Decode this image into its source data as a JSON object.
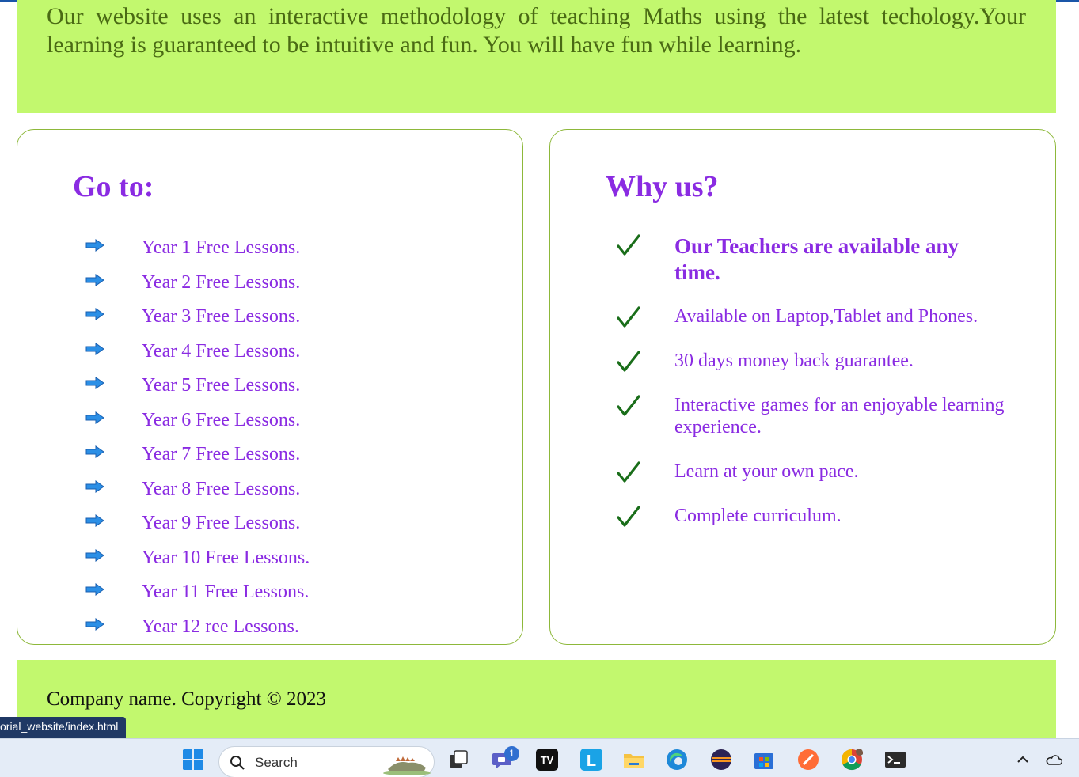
{
  "hero": {
    "text": "Our website uses an interactive methodology of teaching Maths using the latest techology.Your learning is guaranteed to be intuitive and fun. You will have fun while learning."
  },
  "goto": {
    "title": "Go to:",
    "items": [
      "Year 1 Free Lessons.",
      "Year 2 Free Lessons.",
      "Year 3 Free Lessons.",
      "Year 4 Free Lessons.",
      "Year 5 Free Lessons.",
      "Year 6 Free Lessons.",
      "Year 7 Free Lessons.",
      "Year 8 Free Lessons.",
      "Year 9 Free Lessons.",
      "Year 10 Free Lessons.",
      "Year 11 Free Lessons.",
      "Year 12 ree Lessons."
    ],
    "icon": "arrow-right-icon"
  },
  "why": {
    "title": "Why us?",
    "items": [
      "Our Teachers are available any time.",
      "Available on Laptop,Tablet and Phones.",
      "30 days money back guarantee.",
      "Interactive games for an enjoyable learning experience.",
      "Learn at your own pace.",
      "Complete curriculum."
    ],
    "icon": "checkmark-icon"
  },
  "footer": {
    "text": "Company name. Copyright © 2023"
  },
  "status_url": "orial_website/index.html",
  "taskbar": {
    "search_label": "Search",
    "chat_badge": "1",
    "icons": [
      "windows-start-icon",
      "search-icon",
      "task-view-icon",
      "teams-chat-icon",
      "tradingview-icon",
      "l-app-icon",
      "file-explorer-icon",
      "edge-icon",
      "eclipse-icon",
      "microsoft-store-icon",
      "postman-icon",
      "chrome-icon",
      "terminal-icon",
      "chevron-up-icon",
      "onedrive-icon"
    ]
  },
  "colors": {
    "accent_green": "#c2f86e",
    "heading_purple": "#8a2be2",
    "tick_green": "#1a6e1a",
    "hero_text": "#4a6a14"
  }
}
